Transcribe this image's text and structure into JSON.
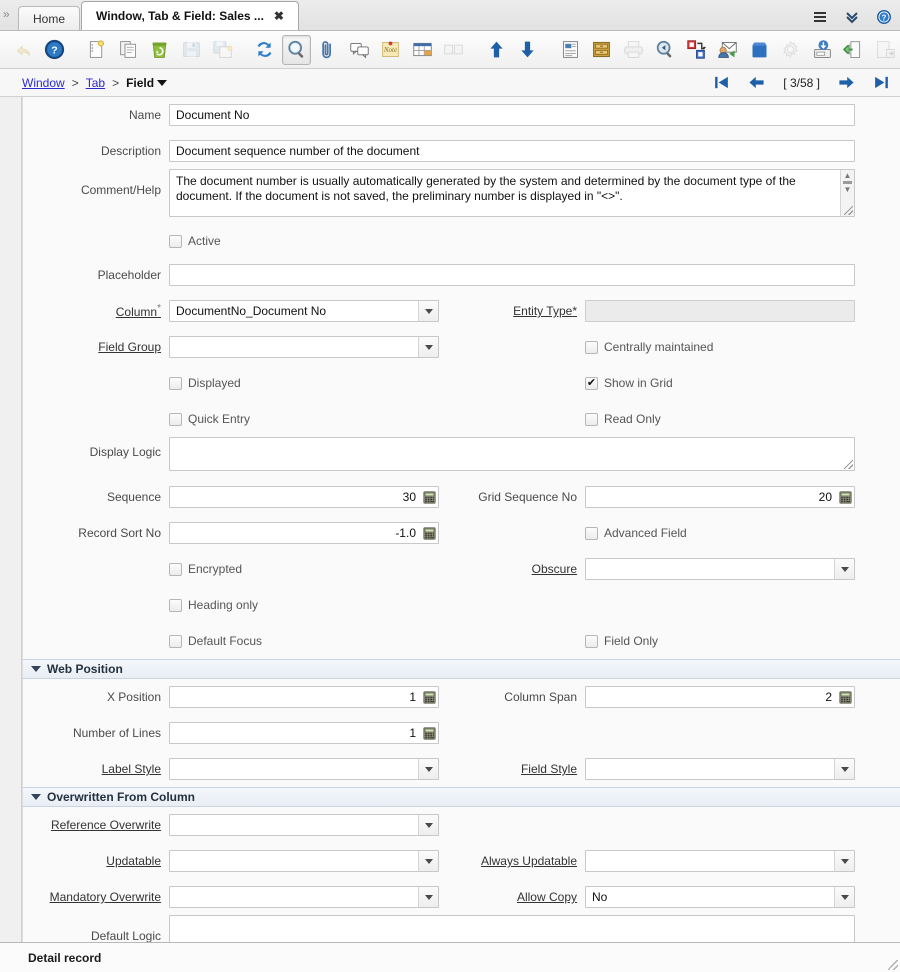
{
  "window": {
    "collapse_icon": "chevron-double-right-icon",
    "tabs": [
      {
        "label": "Home",
        "active": false,
        "closable": false
      },
      {
        "label": "Window, Tab & Field: Sales ...",
        "active": true,
        "closable": true,
        "close_label": "✖"
      }
    ],
    "right_icons": [
      {
        "name": "menu-icon",
        "glyph": "hamburger"
      },
      {
        "name": "chevron-double-down-icon",
        "glyph": "chevdown"
      },
      {
        "name": "help-icon",
        "glyph": "help"
      }
    ]
  },
  "toolbar": {
    "buttons": [
      {
        "name": "undo-button",
        "icon": "undo-arrow-icon",
        "disabled": true,
        "selected": false
      },
      {
        "name": "help-button",
        "icon": "help-icon",
        "disabled": false,
        "selected": false
      },
      {
        "name": "new-record-button",
        "icon": "new-document-icon",
        "disabled": false,
        "selected": false
      },
      {
        "name": "copy-record-button",
        "icon": "copy-documents-icon",
        "disabled": false,
        "selected": false
      },
      {
        "name": "delete-record-button",
        "icon": "recycle-bin-icon",
        "disabled": false,
        "selected": false
      },
      {
        "name": "save-button",
        "icon": "floppy-disk-icon",
        "disabled": true,
        "selected": false
      },
      {
        "name": "save-create-button",
        "icon": "save-new-icon",
        "disabled": true,
        "selected": false
      },
      {
        "name": "refresh-button",
        "icon": "refresh-icon",
        "disabled": false,
        "selected": false
      },
      {
        "name": "find-button",
        "icon": "magnifier-icon",
        "disabled": false,
        "selected": true
      },
      {
        "name": "attachment-button",
        "icon": "paperclip-icon",
        "disabled": false,
        "selected": false
      },
      {
        "name": "chat-button",
        "icon": "speech-bubbles-icon",
        "disabled": false,
        "selected": false
      },
      {
        "name": "note-button",
        "icon": "sticky-note-icon",
        "disabled": false,
        "selected": false
      },
      {
        "name": "grid-toggle-button",
        "icon": "grid-table-icon",
        "disabled": false,
        "selected": false
      },
      {
        "name": "multi-view-button",
        "icon": "panels-icon",
        "disabled": true,
        "selected": false
      },
      {
        "name": "parent-record-button",
        "icon": "blue-up-arrow-icon",
        "disabled": false,
        "selected": false
      },
      {
        "name": "detail-record-button",
        "icon": "blue-down-arrow-icon",
        "disabled": false,
        "selected": false
      },
      {
        "name": "report-button",
        "icon": "report-page-icon",
        "disabled": false,
        "selected": false
      },
      {
        "name": "archive-button",
        "icon": "file-cabinet-icon",
        "disabled": false,
        "selected": false
      },
      {
        "name": "print-button",
        "icon": "printer-icon",
        "disabled": true,
        "selected": false
      },
      {
        "name": "print-preview-button",
        "icon": "zoom-back-icon",
        "disabled": false,
        "selected": false
      },
      {
        "name": "zoom-across-button",
        "icon": "zoom-across-icon",
        "disabled": false,
        "selected": false
      },
      {
        "name": "request-button",
        "icon": "mail-user-icon",
        "disabled": false,
        "selected": false
      },
      {
        "name": "product-info-button",
        "icon": "blue-box-icon",
        "disabled": false,
        "selected": false
      },
      {
        "name": "process-button",
        "icon": "gear-icon",
        "disabled": true,
        "selected": false
      },
      {
        "name": "export-button",
        "icon": "export-drive-icon",
        "disabled": false,
        "selected": false
      },
      {
        "name": "import-button",
        "icon": "import-page-icon",
        "disabled": false,
        "selected": false
      },
      {
        "name": "exit-button",
        "icon": "exit-window-icon",
        "disabled": true,
        "selected": false
      }
    ]
  },
  "breadcrumb": {
    "items": [
      {
        "label": "Window",
        "link": true,
        "current": false
      },
      {
        "label": "Tab",
        "link": true,
        "current": false
      },
      {
        "label": "Field",
        "link": false,
        "current": true
      }
    ],
    "separator": ">",
    "dropdown_icon": "caret-down-icon"
  },
  "record_nav": {
    "first_icon": "first-record-icon",
    "prev_icon": "previous-record-icon",
    "position": "[ 3/58 ]",
    "next_icon": "next-record-icon",
    "last_icon": "last-record-icon"
  },
  "form": {
    "name": {
      "label": "Name",
      "value": "Document No"
    },
    "description": {
      "label": "Description",
      "value": "Document sequence number of the document"
    },
    "comment_help": {
      "label": "Comment/Help",
      "value": "The document number is usually automatically generated by the system and determined by the document type of the document. If the document is not saved, the preliminary number is displayed in \"<>\"."
    },
    "active": {
      "label": "Active",
      "checked": false
    },
    "placeholder": {
      "label": "Placeholder",
      "value": ""
    },
    "column": {
      "label": "Column",
      "value": "DocumentNo_Document No",
      "required": true
    },
    "entity_type": {
      "label": "Entity Type",
      "value": "",
      "required": true,
      "readonly": true
    },
    "field_group": {
      "label": "Field Group",
      "value": ""
    },
    "centrally_maintained": {
      "label": "Centrally maintained",
      "checked": false
    },
    "displayed": {
      "label": "Displayed",
      "checked": false
    },
    "show_in_grid": {
      "label": "Show in Grid",
      "checked": true
    },
    "quick_entry": {
      "label": "Quick Entry",
      "checked": false
    },
    "read_only": {
      "label": "Read Only",
      "checked": false
    },
    "display_logic": {
      "label": "Display Logic",
      "value": ""
    },
    "sequence": {
      "label": "Sequence",
      "value": "30"
    },
    "grid_sequence_no": {
      "label": "Grid Sequence No",
      "value": "20"
    },
    "record_sort_no": {
      "label": "Record Sort No",
      "value": "-1.0"
    },
    "advanced_field": {
      "label": "Advanced Field",
      "checked": false
    },
    "encrypted": {
      "label": "Encrypted",
      "checked": false
    },
    "obscure": {
      "label": "Obscure",
      "value": ""
    },
    "heading_only": {
      "label": "Heading only",
      "checked": false
    },
    "default_focus": {
      "label": "Default Focus",
      "checked": false
    },
    "field_only": {
      "label": "Field Only",
      "checked": false
    }
  },
  "web_position": {
    "title": "Web Position",
    "x_position": {
      "label": "X Position",
      "value": "1"
    },
    "column_span": {
      "label": "Column Span",
      "value": "2"
    },
    "number_of_lines": {
      "label": "Number of Lines",
      "value": "1"
    },
    "label_style": {
      "label": "Label Style",
      "value": ""
    },
    "field_style": {
      "label": "Field Style",
      "value": ""
    }
  },
  "overwritten_from_column": {
    "title": "Overwritten From Column",
    "reference_overwrite": {
      "label": "Reference Overwrite",
      "value": ""
    },
    "updatable": {
      "label": "Updatable",
      "value": ""
    },
    "always_updatable": {
      "label": "Always Updatable",
      "value": ""
    },
    "mandatory_overwrite": {
      "label": "Mandatory Overwrite",
      "value": ""
    },
    "allow_copy": {
      "label": "Allow Copy",
      "value": "No"
    },
    "default_logic": {
      "label": "Default Logic",
      "value": ""
    }
  },
  "status": {
    "text": "Detail record"
  },
  "colors": {
    "accent_blue": "#1F5FA8",
    "link_blue": "#2a2ad0",
    "section_bg": "#e8eef6",
    "form_bg": "#fafafa"
  }
}
